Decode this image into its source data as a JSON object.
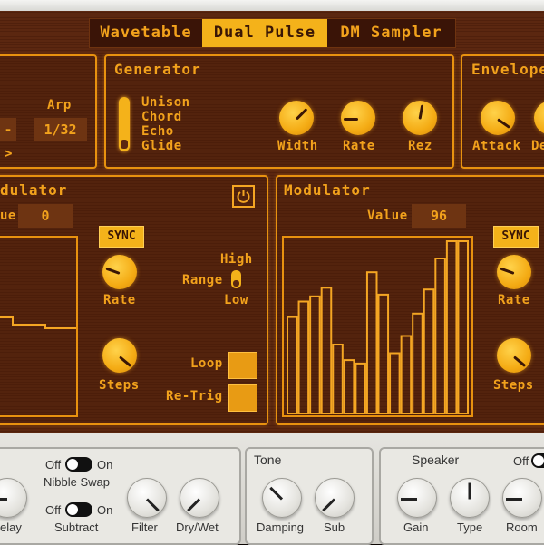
{
  "tabs": [
    {
      "label": "Wavetable",
      "active": false
    },
    {
      "label": "Dual Pulse",
      "active": true
    },
    {
      "label": "DM Sampler",
      "active": false
    }
  ],
  "arp_panel": {
    "title": "Arp",
    "value": "1/32",
    "arrow_value": "->"
  },
  "generator": {
    "title": "Generator",
    "modes": [
      "Unison",
      "Chord",
      "Echo",
      "Glide"
    ],
    "knobs": [
      "Width",
      "Rate",
      "Rez"
    ]
  },
  "envelope": {
    "title": "Envelope",
    "knobs": [
      "Attack",
      "De"
    ]
  },
  "modulator_left": {
    "title": "dulator",
    "value_label": "ue",
    "value": "0",
    "sync_label": "SYNC",
    "rate_label": "Rate",
    "steps_label": "Steps",
    "range_label": "Range",
    "range_high": "High",
    "range_low": "Low",
    "loop_label": "Loop",
    "retrig_label": "Re-Trig"
  },
  "modulator_right": {
    "title": "Modulator",
    "value_label": "Value",
    "value": "96",
    "sync_label": "SYNC",
    "rate_label": "Rate",
    "steps_label": "Steps",
    "steps": [
      0.56,
      0.65,
      0.68,
      0.73,
      0.4,
      0.31,
      0.29,
      0.82,
      0.69,
      0.35,
      0.45,
      0.58,
      0.72,
      0.9,
      1.0,
      1.0
    ]
  },
  "bottom_left": {
    "off_label": "Off",
    "on_label": "On",
    "nibble_swap_label": "Nibble Swap",
    "subtract_label": "Subtract",
    "knobs": [
      "elay",
      "Filter",
      "Dry/Wet"
    ]
  },
  "tone": {
    "title": "Tone",
    "knobs": [
      "Damping",
      "Sub"
    ]
  },
  "speaker": {
    "title": "Speaker",
    "off_label": "Off",
    "knobs": [
      "Gain",
      "Type",
      "Room"
    ]
  },
  "colors": {
    "accent": "#f4a623",
    "screen": "#5b2710",
    "active_tab": "#f4b21a"
  }
}
